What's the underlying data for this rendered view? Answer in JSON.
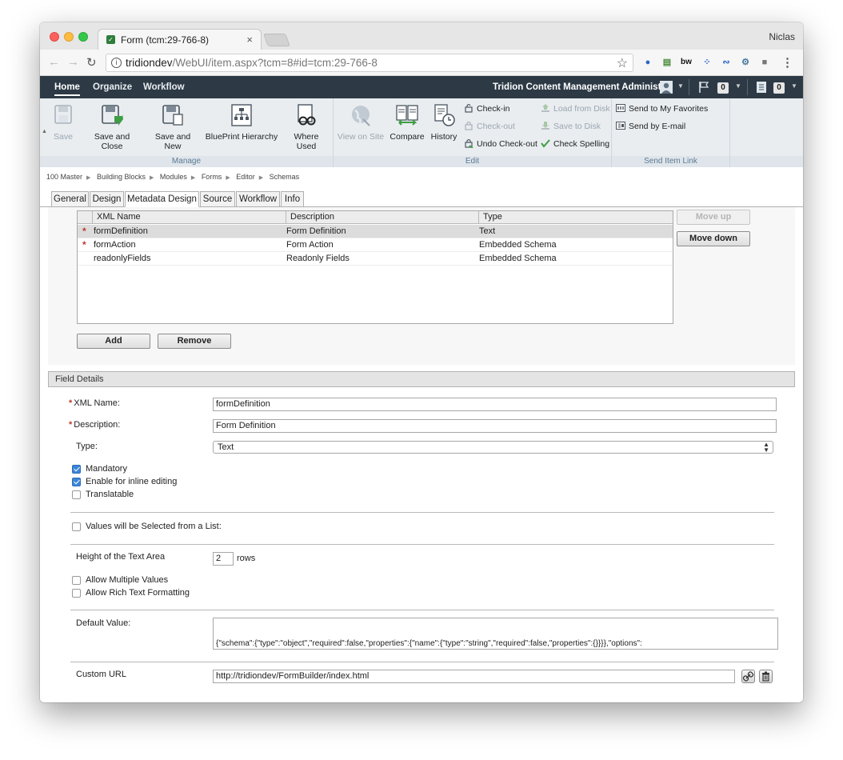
{
  "browser": {
    "tab_title": "Form (tcm:29-766-8)",
    "tab_close": "×",
    "profile_name": "Niclas",
    "url_host": "tridiondev",
    "url_path": "/WebUI/item.aspx?tcm=8#id=tcm:29-766-8",
    "back_icon": "back-arrow-icon",
    "forward_icon": "forward-arrow-icon",
    "reload_icon": "reload-icon"
  },
  "app": {
    "nav": [
      "Home",
      "Organize",
      "Workflow"
    ],
    "title": "Tridion Content Management Administr...",
    "flag_count": "0",
    "list_count": "0",
    "accent": "#2d3a46"
  },
  "ribbon": {
    "manage": {
      "label": "Manage",
      "save": "Save",
      "save_close": "Save and Close",
      "save_new": "Save and New",
      "blueprint": "BluePrint Hierarchy",
      "where_used": "Where Used"
    },
    "edit": {
      "label": "Edit",
      "view_on_site": "View on Site",
      "compare": "Compare",
      "history": "History",
      "check_in": "Check-in",
      "check_out": "Check-out",
      "undo_check_out": "Undo Check-out",
      "load_from_disk": "Load from Disk",
      "save_to_disk": "Save to Disk",
      "check_spelling": "Check Spelling"
    },
    "send": {
      "label": "Send Item Link",
      "favorites": "Send to My Favorites",
      "email": "Send by E-mail"
    }
  },
  "breadcrumb": [
    "100 Master",
    "Building Blocks",
    "Modules",
    "Forms",
    "Editor",
    "Schemas"
  ],
  "tabs": [
    "General",
    "Design",
    "Metadata Design",
    "Source",
    "Workflow",
    "Info"
  ],
  "grid": {
    "columns": [
      "XML Name",
      "Description",
      "Type"
    ],
    "rows": [
      {
        "required": "*",
        "name": "formDefinition",
        "description": "Form Definition",
        "type": "Text"
      },
      {
        "required": "*",
        "name": "formAction",
        "description": "Form Action",
        "type": "Embedded Schema"
      },
      {
        "required": "",
        "name": "readonlyFields",
        "description": "Readonly Fields",
        "type": "Embedded Schema"
      }
    ],
    "move_up": "Move up",
    "move_down": "Move down",
    "add": "Add",
    "remove": "Remove"
  },
  "field_details": {
    "header": "Field Details",
    "xml_name_label": "XML Name:",
    "xml_name_value": "formDefinition",
    "description_label": "Description:",
    "description_value": "Form Definition",
    "type_label": "Type:",
    "type_value": "Text",
    "mandatory": "Mandatory",
    "inline_editing": "Enable for inline editing",
    "translatable": "Translatable",
    "values_from_list": "Values will be Selected from a List:",
    "height_label": "Height of the Text Area",
    "height_value": "2",
    "rows_label": "rows",
    "multiple_values": "Allow Multiple Values",
    "rich_text": "Allow Rich Text Formatting",
    "default_value_label": "Default Value:",
    "default_value": "{\"schema\":{\"type\":\"object\",\"required\":false,\"properties\":{\"name\":{\"type\":\"string\",\"required\":false,\"properties\":{}}}},\"options\":",
    "custom_url_label": "Custom URL",
    "custom_url_value": "http://tridiondev/FormBuilder/index.html",
    "checked": {
      "mandatory": true,
      "inline_editing": true,
      "translatable": false,
      "values_from_list": false,
      "multiple_values": false,
      "rich_text": false
    }
  }
}
